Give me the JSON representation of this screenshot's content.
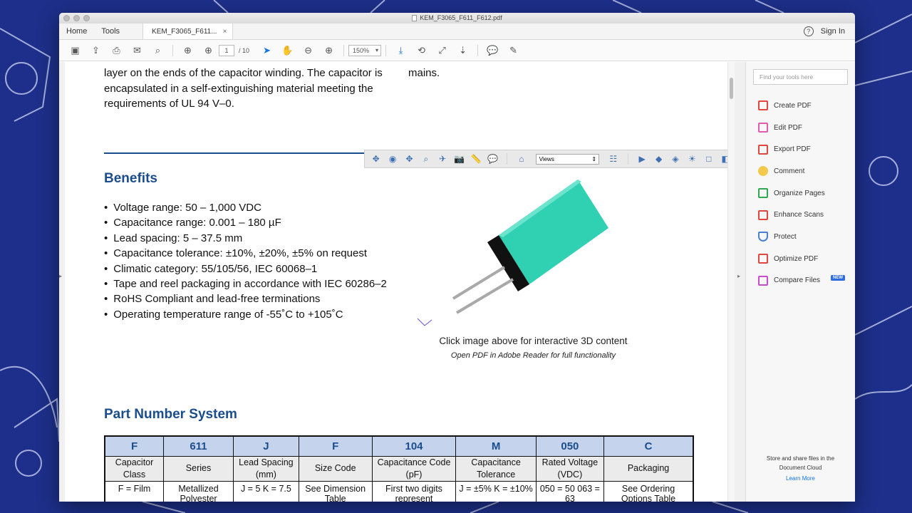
{
  "window": {
    "title": "KEM_F3065_F611_F612.pdf"
  },
  "tabs": {
    "home": "Home",
    "tools": "Tools",
    "document": "KEM_F3065_F611...",
    "close": "×"
  },
  "header": {
    "help": "?",
    "sign_in": "Sign In"
  },
  "toolbar": {
    "page_current": "1",
    "page_total": "/ 10",
    "zoom": "150%"
  },
  "document": {
    "intro_left": [
      "layer on the ends of the capacitor winding. The capacitor is",
      "encapsulated in a self-extinguishing material meeting the",
      "requirements of UL 94 V–0."
    ],
    "intro_right": "mains.",
    "benefits_title": "Benefits",
    "benefits": [
      "Voltage range: 50 – 1,000 VDC",
      "Capacitance range: 0.001 – 180 µF",
      "Lead spacing: 5 – 37.5 mm",
      "Capacitance tolerance: ±10%, ±20%, ±5% on request",
      "Climatic category: 55/105/56, IEC 60068–1",
      "Tape and reel packaging in accordance with IEC 60286–2",
      "RoHS Compliant and lead-free terminations",
      "Operating temperature range of -55˚C to +105˚C"
    ],
    "toolbar3d": {
      "views": "Views"
    },
    "caption": "Click image above for interactive 3D content",
    "caption_sub": "Open PDF in Adobe Reader for full functionality",
    "part_number_title": "Part Number System",
    "table": {
      "letters": [
        "F",
        "611",
        "J",
        "F",
        "104",
        "M",
        "050",
        "C"
      ],
      "labels": [
        "Capacitor Class",
        "Series",
        "Lead Spacing (mm)",
        "Size Code",
        "Capacitance Code (pF)",
        "Capacitance Tolerance",
        "Rated Voltage (VDC)",
        "Packaging"
      ],
      "values": [
        "F = Film",
        "Metallized Polyester",
        "J = 5 K = 7.5",
        "See Dimension Table",
        "First two digits represent",
        "J = ±5% K = ±10%",
        "050 = 50 063 = 63",
        "See Ordering Options Table"
      ]
    }
  },
  "right_panel": {
    "search_placeholder": "Find your tools here",
    "tools": [
      {
        "label": "Create PDF",
        "icon": "create-pdf-icon",
        "color": "#e0483f"
      },
      {
        "label": "Edit PDF",
        "icon": "edit-pdf-icon",
        "color": "#e05cae"
      },
      {
        "label": "Export PDF",
        "icon": "export-pdf-icon",
        "color": "#e0483f"
      },
      {
        "label": "Comment",
        "icon": "comment-icon",
        "color": "#f2c94c"
      },
      {
        "label": "Organize Pages",
        "icon": "organize-pages-icon",
        "color": "#33a853"
      },
      {
        "label": "Enhance Scans",
        "icon": "enhance-scans-icon",
        "color": "#e0483f"
      },
      {
        "label": "Protect",
        "icon": "protect-icon",
        "color": "#4a7fd6"
      },
      {
        "label": "Optimize PDF",
        "icon": "optimize-pdf-icon",
        "color": "#e0483f"
      },
      {
        "label": "Compare Files",
        "icon": "compare-files-icon",
        "color": "#c84ccf"
      }
    ],
    "new_badge": "NEW",
    "cloud_text": "Store and share files in the Document Cloud",
    "learn_more": "Learn More"
  }
}
